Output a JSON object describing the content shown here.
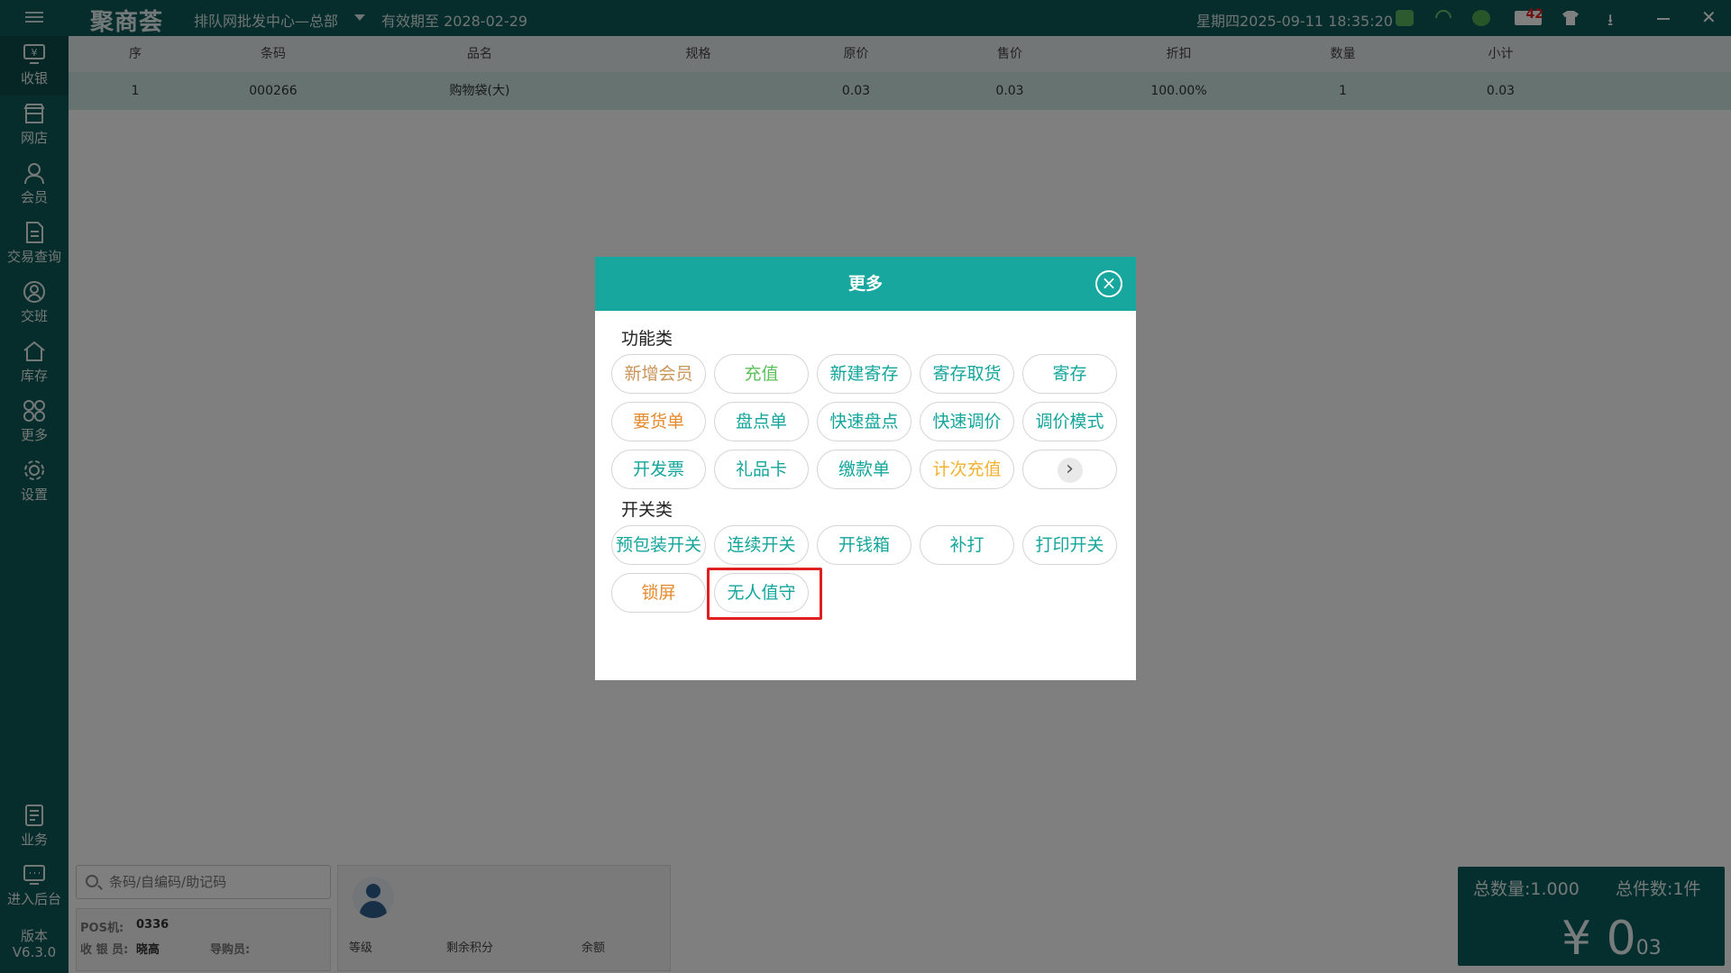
{
  "titlebar": {
    "logo": "聚商荟",
    "store": "排队网批发中心—总部",
    "expiry": "有效期至 2028-02-29",
    "datetime": "星期四2025-09-11 18:35:20",
    "message_count": "42"
  },
  "sidebar": {
    "items": [
      {
        "label": "收银",
        "icon": "cashier-icon"
      },
      {
        "label": "网店",
        "icon": "store-icon"
      },
      {
        "label": "会员",
        "icon": "member-icon"
      },
      {
        "label": "交易查询",
        "icon": "document-icon"
      },
      {
        "label": "交班",
        "icon": "handover-icon"
      },
      {
        "label": "库存",
        "icon": "home-icon"
      },
      {
        "label": "更多",
        "icon": "grid-icon"
      },
      {
        "label": "设置",
        "icon": "gear-icon"
      },
      {
        "label": "业务",
        "icon": "business-icon"
      },
      {
        "label": "进入后台",
        "icon": "backend-icon"
      }
    ],
    "version_label": "版本",
    "version": "V6.3.0"
  },
  "table": {
    "headers": [
      "序",
      "条码",
      "品名",
      "规格",
      "原价",
      "售价",
      "折扣",
      "数量",
      "小计"
    ],
    "rows": [
      [
        "1",
        "000266",
        "购物袋(大)",
        "",
        "0.03",
        "0.03",
        "100.00%",
        "1",
        "0.03"
      ]
    ]
  },
  "bottom": {
    "search_placeholder": "条码/自编码/助记码",
    "pos_label": "POS机:",
    "pos_value": "0336",
    "cashier_label": "收 银 员:",
    "cashier_value": "晓高",
    "guide_label": "导购员:",
    "member_level": "等级",
    "member_points": "剩余积分",
    "member_balance": "余额",
    "total_qty": "总数量:1.000",
    "total_count": "总件数:1件",
    "total_amount_main": "¥ 0",
    "total_amount_cents": "03"
  },
  "dialog": {
    "title": "更多",
    "close_symbol": "×",
    "function_section": "功能类",
    "switch_section": "开关类",
    "function_buttons": [
      "新增会员",
      "充值",
      "新建寄存",
      "寄存取货",
      "寄存",
      "要货单",
      "盘点单",
      "快速盘点",
      "快速调价",
      "调价模式",
      "开发票",
      "礼品卡",
      "缴款单",
      "计次充值"
    ],
    "next_symbol": "›",
    "switch_buttons": [
      "预包装开关",
      "连续开关",
      "开钱箱",
      "补打",
      "打印开关",
      "锁屏",
      "无人值守"
    ]
  }
}
